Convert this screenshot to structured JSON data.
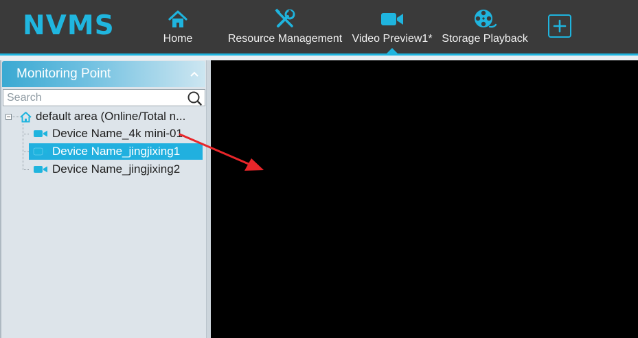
{
  "app": {
    "logo": "NVMS"
  },
  "nav": {
    "items": [
      {
        "label": "Home",
        "icon": "home-icon"
      },
      {
        "label": "Resource Management",
        "icon": "tools-icon"
      },
      {
        "label": "Video Preview1*",
        "icon": "video-camera-icon"
      },
      {
        "label": "Storage Playback",
        "icon": "film-reel-icon"
      }
    ],
    "active_index": 2,
    "add_tab_icon": "plus-icon"
  },
  "panel": {
    "title": "Monitoring Point",
    "search": {
      "placeholder": "Search",
      "value": ""
    },
    "tree": {
      "area": {
        "label": "default area (Online/Total n...",
        "icon": "home-icon",
        "expanded": true
      },
      "devices": [
        {
          "label": "Device Name_4k mini-01",
          "icon": "camera-icon",
          "selected": false
        },
        {
          "label": "Device Name_jingjixing1",
          "icon": "camera-icon",
          "selected": true
        },
        {
          "label": "Device Name_jingjixing2",
          "icon": "camera-icon",
          "selected": false
        }
      ]
    }
  },
  "colors": {
    "accent": "#1fb4de",
    "topbar": "#3a3a3a",
    "selected_row": "#21b0df",
    "annotation_arrow": "#e8262a",
    "video_bg": "#000000"
  }
}
